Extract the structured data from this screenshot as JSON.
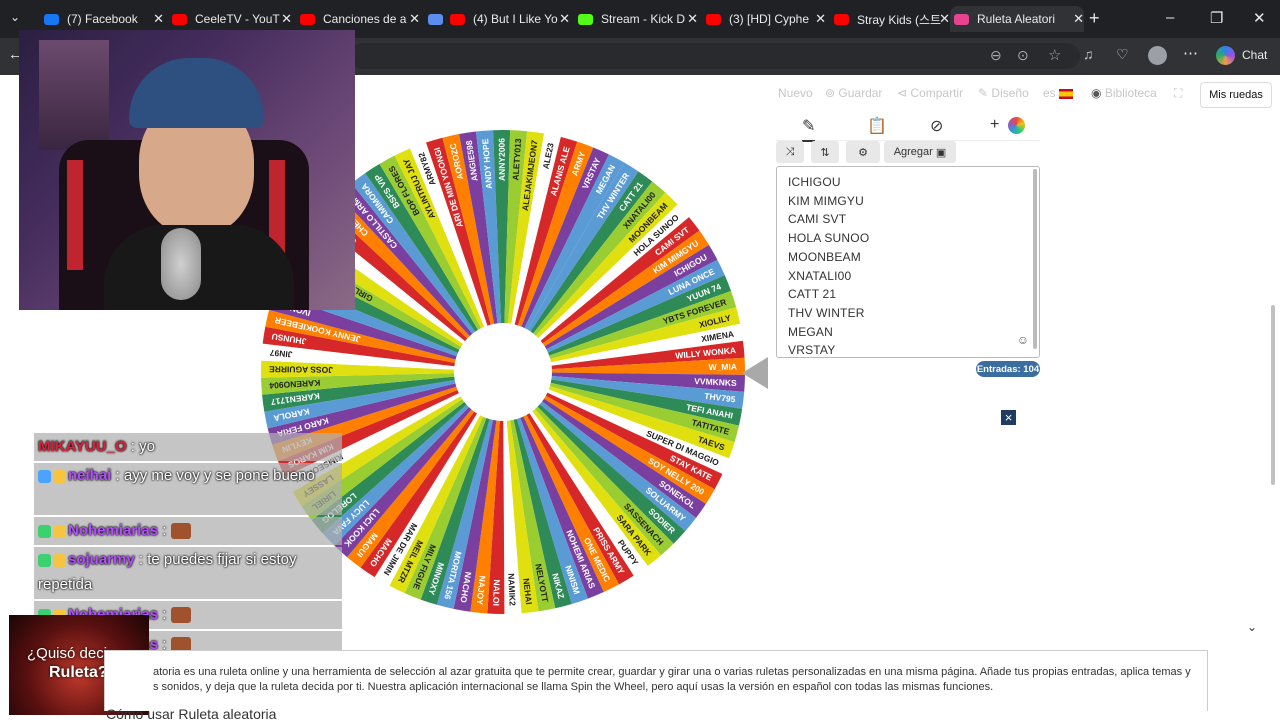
{
  "browser": {
    "tabs": [
      {
        "label": "(7) Facebook",
        "color": "#1877f2"
      },
      {
        "label": "CeeleTV - YouT",
        "color": "#ff0000"
      },
      {
        "label": "Canciones de a",
        "color": "#ff0000"
      },
      {
        "label": "",
        "color": "#5b8def"
      },
      {
        "label": "(4) But I Like Yo",
        "color": "#ff0000"
      },
      {
        "label": "Stream - Kick D",
        "color": "#53fc18"
      },
      {
        "label": "(3) [HD] Cyphe",
        "color": "#ff0000"
      },
      {
        "label": "Stray Kids (스트",
        "color": "#ff0000"
      },
      {
        "label": "Ruleta Aleatori",
        "color": "#e84393"
      }
    ],
    "new_tab": "+",
    "chat_label": "Chat"
  },
  "toolbar": {
    "nuevo": "Nuevo",
    "guardar": "Guardar",
    "compartir": "Compartir",
    "diseno": "Diseño",
    "lang": "es",
    "biblioteca": "Biblioteca",
    "mis_ruedas": "Mis ruedas"
  },
  "panel": {
    "plus": "+",
    "agregar": "Agregar",
    "entries": [
      "ICHIGOU",
      "KIM MIMGYU",
      "CAMI SVT",
      "HOLA SUNOO",
      "MOONBEAM",
      "XNATALI00",
      "CATT 21",
      "THV WINTER",
      "MEGAN",
      "VRSTAY"
    ],
    "count": "Entradas: 104"
  },
  "wheel": {
    "colors": [
      "#5b9bd5",
      "#2e8b57",
      "#9acd32",
      "#e0e010",
      "#ffffff",
      "#d62828",
      "#ff7f00",
      "#7b3fa0"
    ],
    "labels": [
      "THV WINTER",
      "CATT 21",
      "XNATALI00",
      "MOONBEAM",
      "HOLA SUNOO",
      "CAMI SVT",
      "KIM MIMGYU",
      "ICHIGOU",
      "LUNA ONCE",
      "YUUN 74",
      "YBTS FOREVER",
      "XIOLILY",
      "XIMENA",
      "WILLY WONKA",
      "W_MIA",
      "VVMKNKS",
      "THV795",
      "TEFI ANAHI",
      "TATITATE",
      "TAEVS",
      "SUPER DI MAGGIO",
      "STAY KATE",
      "SOY NELLY 200",
      "SONEKOL",
      "SOLUARMY",
      "SODIER",
      "SASSENACH",
      "SARA PARK",
      "PUPPY",
      "PRISS ARMY",
      "ONE MEDIC",
      "NOHEMI ARIAS",
      "NINISM",
      "NIKAZ",
      "NELYOTT",
      "NEHAI",
      "NAMIK2",
      "NALOI",
      "NAJOY",
      "NACHO",
      "MORITA 156",
      "MINOXY",
      "MILY FIGUE",
      "MEIL MTZR",
      "MAR DE JIMIN",
      "MACHO",
      "MAGUI",
      "LUCI KOOK",
      "LUCY FAVA",
      "LORELOG",
      "LIRIEL",
      "LASSEY",
      "KIMSEOKJIN",
      "KIM KAROS",
      "KEYLIN",
      "KARO FERIA",
      "KAROLA",
      "KAREN1717",
      "KARENO904",
      "JOSS AGUIRRE",
      "JIN97",
      "JHUNSU",
      "JENNY KOOKIEBEER",
      "IVONNE",
      "ITZZ ISA",
      "HARUKA",
      "GIRLS GENERATION",
      "FLORES",
      "EMILY",
      "CYNTHIA",
      "CHELSEA",
      "CASTILLO ARMY",
      "CAMIMORA",
      "BSFS VIP",
      "BOP FLORES",
      "AYLINTRUJ JAY",
      "ARMY82",
      "ARI DE MIN YOONGI",
      "AOROZC",
      "ANGIE598",
      "ANDY HOPE",
      "ANNY2006",
      "ALETY013",
      "ALEJAKIMJEON7",
      "ALE23",
      "ALANIS ALE",
      "ARMY",
      "VRSTAY",
      "MEGAN"
    ],
    "close_icon": "×"
  },
  "chat": {
    "rows": [
      {
        "user": "MIKAYUU_O",
        "user_color": "#e0203a",
        "text": ": yo",
        "emote": false
      },
      {
        "user": "neihai",
        "user_color": "#b44cff",
        "text": ": ayy me voy y se pone bueno",
        "emote": false
      },
      {
        "user": "Nohemiarias",
        "user_color": "#b44cff",
        "text": ":",
        "emote": true
      },
      {
        "user": "sojuarmy",
        "user_color": "#b44cff",
        "text": ": te puedes fijar si estoy repetida",
        "emote": false
      },
      {
        "user": "Nohemiarias",
        "user_color": "#b44cff",
        "text": ":",
        "emote": true
      },
      {
        "user": "Nohemiarias",
        "user_color": "#b44cff",
        "text": ":",
        "emote": true
      }
    ]
  },
  "promo": {
    "line1": "¿Quisó decir",
    "line2": "Ruleta?"
  },
  "article": {
    "text": "atoria es una ruleta online y una herramienta de selección al azar gratuita que te permite crear, guardar y girar una o varias ruletas personalizadas en una misma página. Añade tus propias entradas, aplica temas y s sonidos, y deja que la ruleta decida por ti. Nuestra aplicación internacional se llama Spin the Wheel, pero aquí usas la versión en español con todas las mismas funciones.",
    "heading": "Cómo usar Ruleta aleatoria"
  }
}
